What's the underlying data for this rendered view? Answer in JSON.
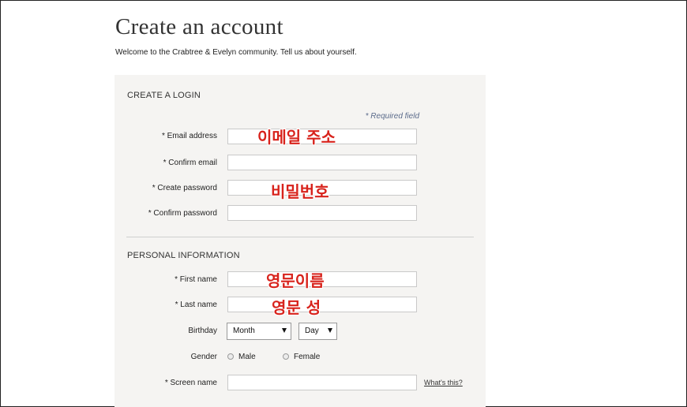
{
  "header": {
    "title": "Create an account",
    "subtitle": "Welcome to the Crabtree & Evelyn community. Tell us about yourself."
  },
  "login": {
    "section_title": "CREATE A LOGIN",
    "required_note": "* Required field",
    "email_label": "* Email address",
    "confirm_email_label": "* Confirm email",
    "password_label": "* Create password",
    "confirm_password_label": "* Confirm password"
  },
  "personal": {
    "section_title": "PERSONAL INFORMATION",
    "first_name_label": "* First name",
    "last_name_label": "* Last name",
    "birthday_label": "Birthday",
    "month_value": "Month",
    "day_value": "Day",
    "gender_label": "Gender",
    "gender_male": "Male",
    "gender_female": "Female",
    "screen_name_label": "* Screen name",
    "whats_this": "What's this?"
  },
  "annotations": {
    "email": "이메일 주소",
    "password": "비밀번호",
    "first_name": "영문이름",
    "last_name": "영문 성"
  },
  "colors": {
    "panel_background": "#f5f4f2",
    "annotation_red": "#d8231c",
    "required_note": "#5a6a8a"
  }
}
